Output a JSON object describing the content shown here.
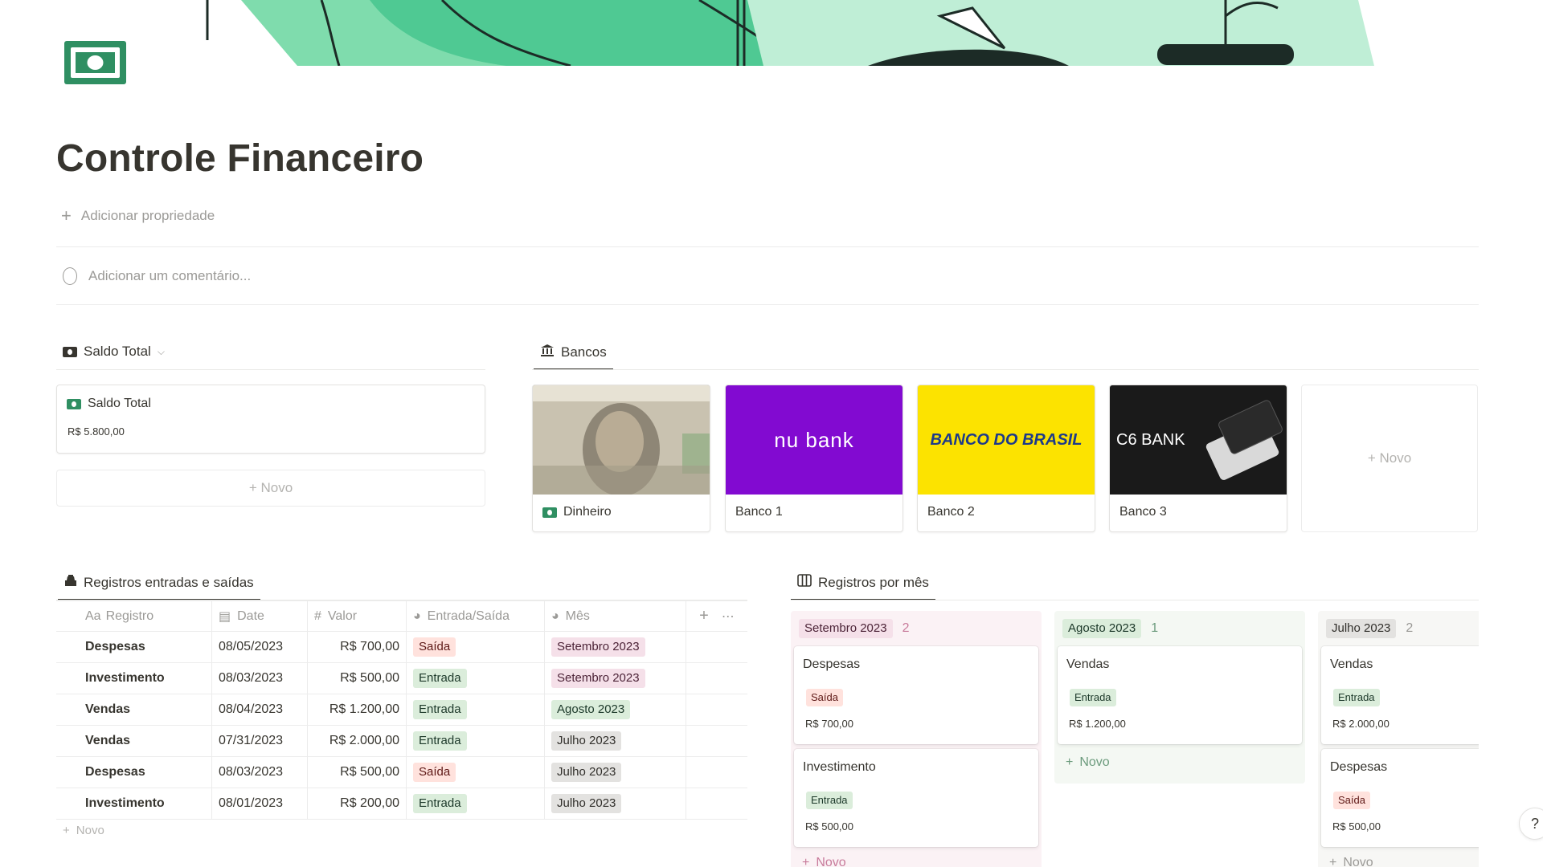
{
  "page": {
    "title": "Controle Financeiro",
    "add_property": "Adicionar propriedade",
    "add_comment": "Adicionar um comentário..."
  },
  "saldo": {
    "tab_label": "Saldo Total",
    "card_title": "Saldo Total",
    "card_value": "R$ 5.800,00",
    "new_label": "+ Novo"
  },
  "bancos": {
    "tab_label": "Bancos",
    "cards": [
      {
        "label": "Dinheiro",
        "image_text": ""
      },
      {
        "label": "Banco 1",
        "image_text": "nu bank",
        "color": "#820ad1"
      },
      {
        "label": "Banco 2",
        "image_text": "BANCO DO BRASIL",
        "color": "#fce300"
      },
      {
        "label": "Banco 3",
        "image_text": "C6 BANK",
        "color": "#1a1a1a"
      }
    ],
    "new_label": "+ Novo"
  },
  "registros": {
    "tab_label": "Registros entradas e saídas",
    "headers": [
      "Registro",
      "Date",
      "Valor",
      "Entrada/Saída",
      "Mês"
    ],
    "header_prefix": "Aa",
    "rows": [
      {
        "registro": "Despesas",
        "date": "08/05/2023",
        "valor": "R$ 700,00",
        "tipo": "Saída",
        "mes": "Setembro 2023"
      },
      {
        "registro": "Investimento",
        "date": "08/03/2023",
        "valor": "R$ 500,00",
        "tipo": "Entrada",
        "mes": "Setembro 2023"
      },
      {
        "registro": "Vendas",
        "date": "08/04/2023",
        "valor": "R$ 1.200,00",
        "tipo": "Entrada",
        "mes": "Agosto 2023"
      },
      {
        "registro": "Vendas",
        "date": "07/31/2023",
        "valor": "R$ 2.000,00",
        "tipo": "Entrada",
        "mes": "Julho 2023"
      },
      {
        "registro": "Despesas",
        "date": "08/03/2023",
        "valor": "R$ 500,00",
        "tipo": "Saída",
        "mes": "Julho 2023"
      },
      {
        "registro": "Investimento",
        "date": "08/01/2023",
        "valor": "R$ 200,00",
        "tipo": "Entrada",
        "mes": "Julho 2023"
      }
    ],
    "new_label": "Novo"
  },
  "por_mes": {
    "tab_label": "Registros por mês",
    "columns": [
      {
        "name": "Setembro 2023",
        "count": "2",
        "cards": [
          {
            "title": "Despesas",
            "tipo": "Saída",
            "valor": "R$ 700,00"
          },
          {
            "title": "Investimento",
            "tipo": "Entrada",
            "valor": "R$ 500,00"
          }
        ]
      },
      {
        "name": "Agosto 2023",
        "count": "1",
        "cards": [
          {
            "title": "Vendas",
            "tipo": "Entrada",
            "valor": "R$ 1.200,00"
          }
        ]
      },
      {
        "name": "Julho 2023",
        "count": "2",
        "cards": [
          {
            "title": "Vendas",
            "tipo": "Entrada",
            "valor": "R$ 2.000,00"
          },
          {
            "title": "Despesas",
            "tipo": "Saída",
            "valor": "R$ 500,00"
          }
        ]
      }
    ],
    "new_label": "Novo"
  },
  "help_label": "?"
}
